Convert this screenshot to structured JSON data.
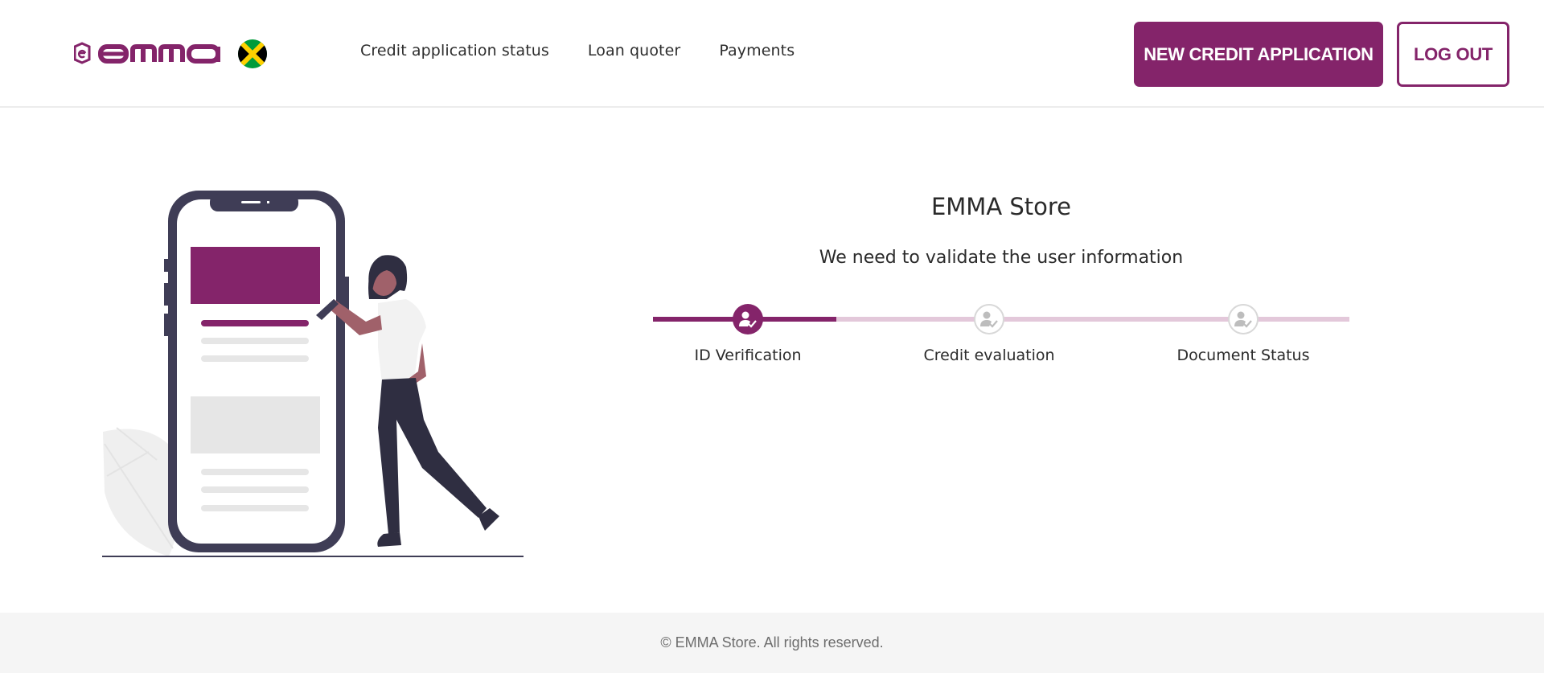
{
  "header": {
    "logo_text": "emma",
    "flag_icon": "jamaica-flag-icon",
    "nav": [
      {
        "label": "Credit application status"
      },
      {
        "label": "Loan quoter"
      },
      {
        "label": "Payments"
      }
    ],
    "new_application_label": "NEW CREDIT APPLICATION",
    "logout_label": "LOG OUT"
  },
  "main": {
    "store_name": "EMMA Store",
    "message": "We need to validate the user information",
    "illustration_icon": "woman-with-phone-illustration",
    "steps": [
      {
        "label": "ID Verification",
        "status": "active",
        "icon": "user-check-icon"
      },
      {
        "label": "Credit evaluation",
        "status": "pending",
        "icon": "user-check-icon"
      },
      {
        "label": "Document Status",
        "status": "pending",
        "icon": "user-check-icon"
      }
    ]
  },
  "footer": {
    "copyright": "© EMMA Store. All rights reserved."
  },
  "colors": {
    "brand": "#84246a",
    "track_inactive": "#e3c8da",
    "footer_bg": "#f5f5f5"
  }
}
